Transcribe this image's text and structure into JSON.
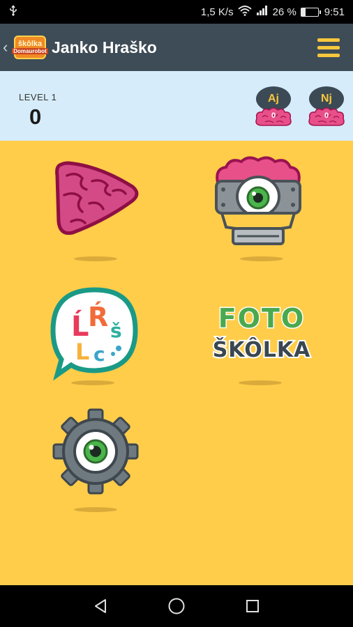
{
  "status_bar": {
    "network_speed": "1,5 K/s",
    "battery_percent": "26 %",
    "time": "9:51",
    "icons": [
      "usb-icon",
      "wifi-icon",
      "signal-icon",
      "battery-icon"
    ]
  },
  "app_bar": {
    "logo_line1": "škôlka",
    "logo_line2": "Domaurobot",
    "user_name": "Janko Hraško",
    "icons": [
      "back-chevron-icon",
      "hamburger-menu-icon"
    ],
    "accent_color": "#f7c73b",
    "bar_color": "#3e4c57"
  },
  "level_panel": {
    "label": "LEVEL 1",
    "value": "0",
    "languages": [
      {
        "code": "Aj",
        "count": "0"
      },
      {
        "code": "Nj",
        "count": "0"
      }
    ]
  },
  "main": {
    "background_color": "#ffcd4a",
    "tiles": [
      {
        "icon": "brain-play-icon"
      },
      {
        "icon": "robot-monster-icon"
      },
      {
        "icon": "letters-speech-bubble-icon",
        "letters": [
          "Ĺ",
          "Ŕ",
          "L",
          "c",
          "š"
        ]
      },
      {
        "icon": "foto-skolka-logo",
        "line1": "FOTO",
        "line2": "ŠKÔLKA"
      },
      {
        "icon": "settings-gear-eye-icon"
      }
    ]
  },
  "nav_bar": {
    "icons": [
      "back-triangle-icon",
      "home-circle-icon",
      "recents-square-icon"
    ]
  }
}
